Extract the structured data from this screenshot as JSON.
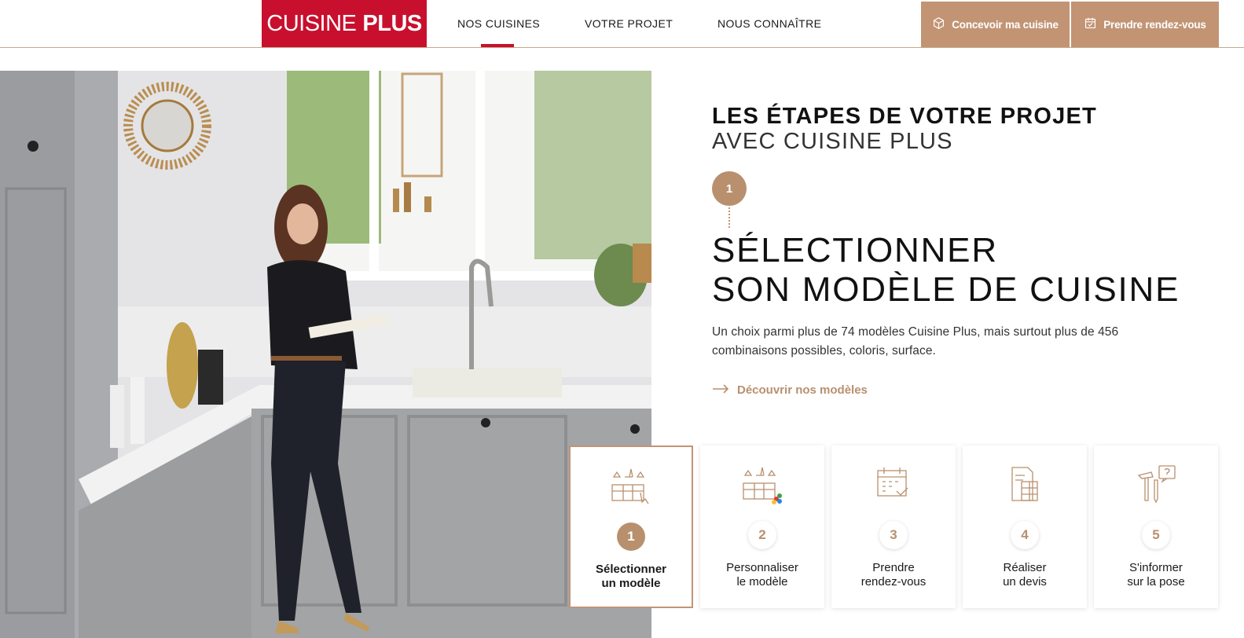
{
  "header": {
    "logo": {
      "part1": "CUISINE",
      "part2": "PLUS"
    },
    "nav": [
      {
        "label": "NOS CUISINES",
        "active": true
      },
      {
        "label": "VOTRE PROJET",
        "active": false
      },
      {
        "label": "NOUS CONNAÎTRE",
        "active": false
      }
    ],
    "cta_design": "Concevoir ma cuisine",
    "cta_appointment": "Prendre rendez-vous"
  },
  "colors": {
    "brand_red": "#c8102e",
    "accent_bronze": "#c29474"
  },
  "hero": {
    "icons": [
      "kitchen-photo"
    ]
  },
  "section": {
    "title_line1": "LES ÉTAPES DE VOTRE PROJET",
    "title_line2": "AVEC CUISINE PLUS",
    "current_step_number": "1",
    "current_title_line1": "SÉLECTIONNER",
    "current_title_line2": "SON MODÈLE DE CUISINE",
    "current_description": "Un choix parmi plus de 74 modèles Cuisine Plus, mais surtout plus de 456 combinaisons possibles, coloris, surface.",
    "current_link": "Découvrir nos modèles"
  },
  "steps": [
    {
      "number": "1",
      "line1": "Sélectionner",
      "line2": "un modèle",
      "icon": "kitchen-select-icon",
      "active": true
    },
    {
      "number": "2",
      "line1": "Personnaliser",
      "line2": "le modèle",
      "icon": "kitchen-color-icon",
      "active": false
    },
    {
      "number": "3",
      "line1": "Prendre",
      "line2": "rendez-vous",
      "icon": "calendar-check-icon",
      "active": false
    },
    {
      "number": "4",
      "line1": "Réaliser",
      "line2": "un devis",
      "icon": "quote-calculator-icon",
      "active": false
    },
    {
      "number": "5",
      "line1": "S'informer",
      "line2": "sur la pose",
      "icon": "tools-question-icon",
      "active": false
    }
  ]
}
